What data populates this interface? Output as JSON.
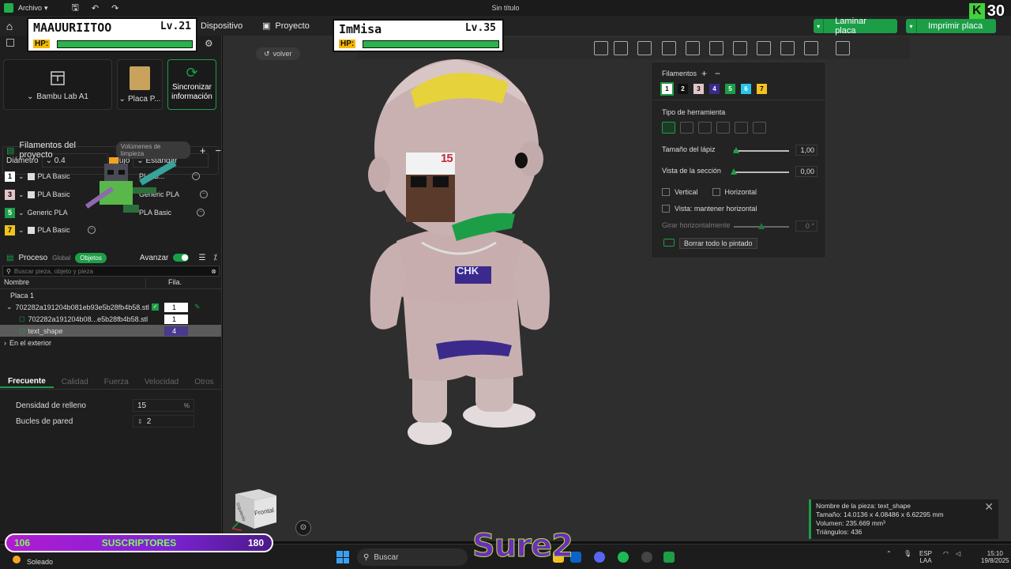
{
  "titlebar": {
    "menu_label": "Archivo",
    "doc_title": "Sin título"
  },
  "stream_badge": {
    "letter": "K",
    "count": "30"
  },
  "nav": {
    "device": "Dispositivo",
    "project": "Proyecto",
    "slice_label": "Laminar placa",
    "print_label": "Imprimir placa"
  },
  "left": {
    "printer_name": "Bambu Lab A1",
    "plate_name": "Placa P...",
    "sync_label_1": "Sincronizar",
    "sync_label_2": "información",
    "diameter_label": "Diámetro",
    "diameter_value": "0.4",
    "flow_label": "Flujo",
    "flow_value": "Estándar",
    "filaments_title": "Filamentos del proyecto",
    "filaments_pill": "Volúmenes de limpieza",
    "filaments": [
      {
        "num": "1",
        "name": "PLA Basic",
        "color": "#ffffff",
        "text": "#000000"
      },
      {
        "num": "3",
        "name": "PLA Basic",
        "color": "#e2c5c8",
        "text": "#000000"
      },
      {
        "num": "5",
        "name": "Generic PLA",
        "color": "#1c9e47",
        "text": "#ffffff"
      },
      {
        "num": "7",
        "name": "PLA Basic",
        "color": "#f2c21f",
        "text": "#000000"
      }
    ],
    "filaments_right": [
      {
        "name": "PLA B..."
      },
      {
        "name": "Generic PLA"
      },
      {
        "name": "PLA Basic"
      }
    ],
    "process_title": "Proceso",
    "global_label": "Global",
    "objects_label": "Objetos",
    "advanced_label": "Avanzar",
    "search_placeholder": "Buscar pieza, objeto y pieza",
    "col_name": "Nombre",
    "col_fila": "Fila.",
    "plate_label": "Placa 1",
    "obj1_name": "702282a191204b081eb93e5b28fb4b58.stl",
    "obj1_fila": "1",
    "obj2_name": "702282a191204b08...e5b28fb4b58.stl",
    "obj2_fila": "1",
    "obj3_name": "text_shape",
    "obj3_fila": "4",
    "outside_label": "En el exterior",
    "tabs": [
      "Frecuente",
      "Calidad",
      "Fuerza",
      "Velocidad",
      "Otros"
    ],
    "infill_label": "Densidad de relleno",
    "infill_value": "15",
    "infill_unit": "%",
    "walls_label": "Bucles de pared",
    "walls_value": "2"
  },
  "viewport": {
    "back_label": "volver",
    "cube_front": "Frontal",
    "cube_side": "Izquierdo"
  },
  "paint": {
    "filaments_title": "Filamentos",
    "swatches": [
      {
        "num": "1",
        "color": "#ffffff",
        "text": "#000000"
      },
      {
        "num": "2",
        "color": "#111111",
        "text": "#ffffff"
      },
      {
        "num": "3",
        "color": "#e2c5c8",
        "text": "#000000"
      },
      {
        "num": "4",
        "color": "#3b2a8c",
        "text": "#ffffff"
      },
      {
        "num": "5",
        "color": "#1c9e47",
        "text": "#ffffff"
      },
      {
        "num": "6",
        "color": "#27c6e8",
        "text": "#ffffff"
      },
      {
        "num": "7",
        "color": "#f2c21f",
        "text": "#000000"
      }
    ],
    "tool_type_label": "Tipo de herramienta",
    "pen_size_label": "Tamaño del lápiz",
    "pen_size_value": "1,00",
    "section_view_label": "Vista de la sección",
    "section_view_value": "0,00",
    "vertical_label": "Vertical",
    "horizontal_label": "Horizontal",
    "keep_horizontal_label": "Vista: mantener horizontal",
    "rotate_label": "Girar horizontalmente",
    "rotate_value": "0 °",
    "clear_label": "Borrar todo lo pintado"
  },
  "info": {
    "line1": "Nombre de la pieza: text_shape",
    "line2": "Tamaño: 14.0136 x 4.08486 x 6.62295 mm",
    "line3": "Volumen: 235.669 mm³",
    "line4": "Triángulos: 436"
  },
  "overlays": {
    "player1_name": "MAAUURIITOO",
    "player1_level": "Lv.21",
    "player2_name": "ImMisa",
    "player2_level": "Lv.35",
    "hp_label": "HP:",
    "subs_from": "106",
    "subs_label": "SUSCRIPTORES",
    "subs_to": "180",
    "watermark": "Sure2",
    "model_badge": "15",
    "chest_text": "CHK"
  },
  "taskbar": {
    "weather": "Soleado",
    "search": "Buscar",
    "lang_1": "ESP",
    "lang_2": "LAA",
    "time": "15:10",
    "date": "19/8/2025"
  }
}
